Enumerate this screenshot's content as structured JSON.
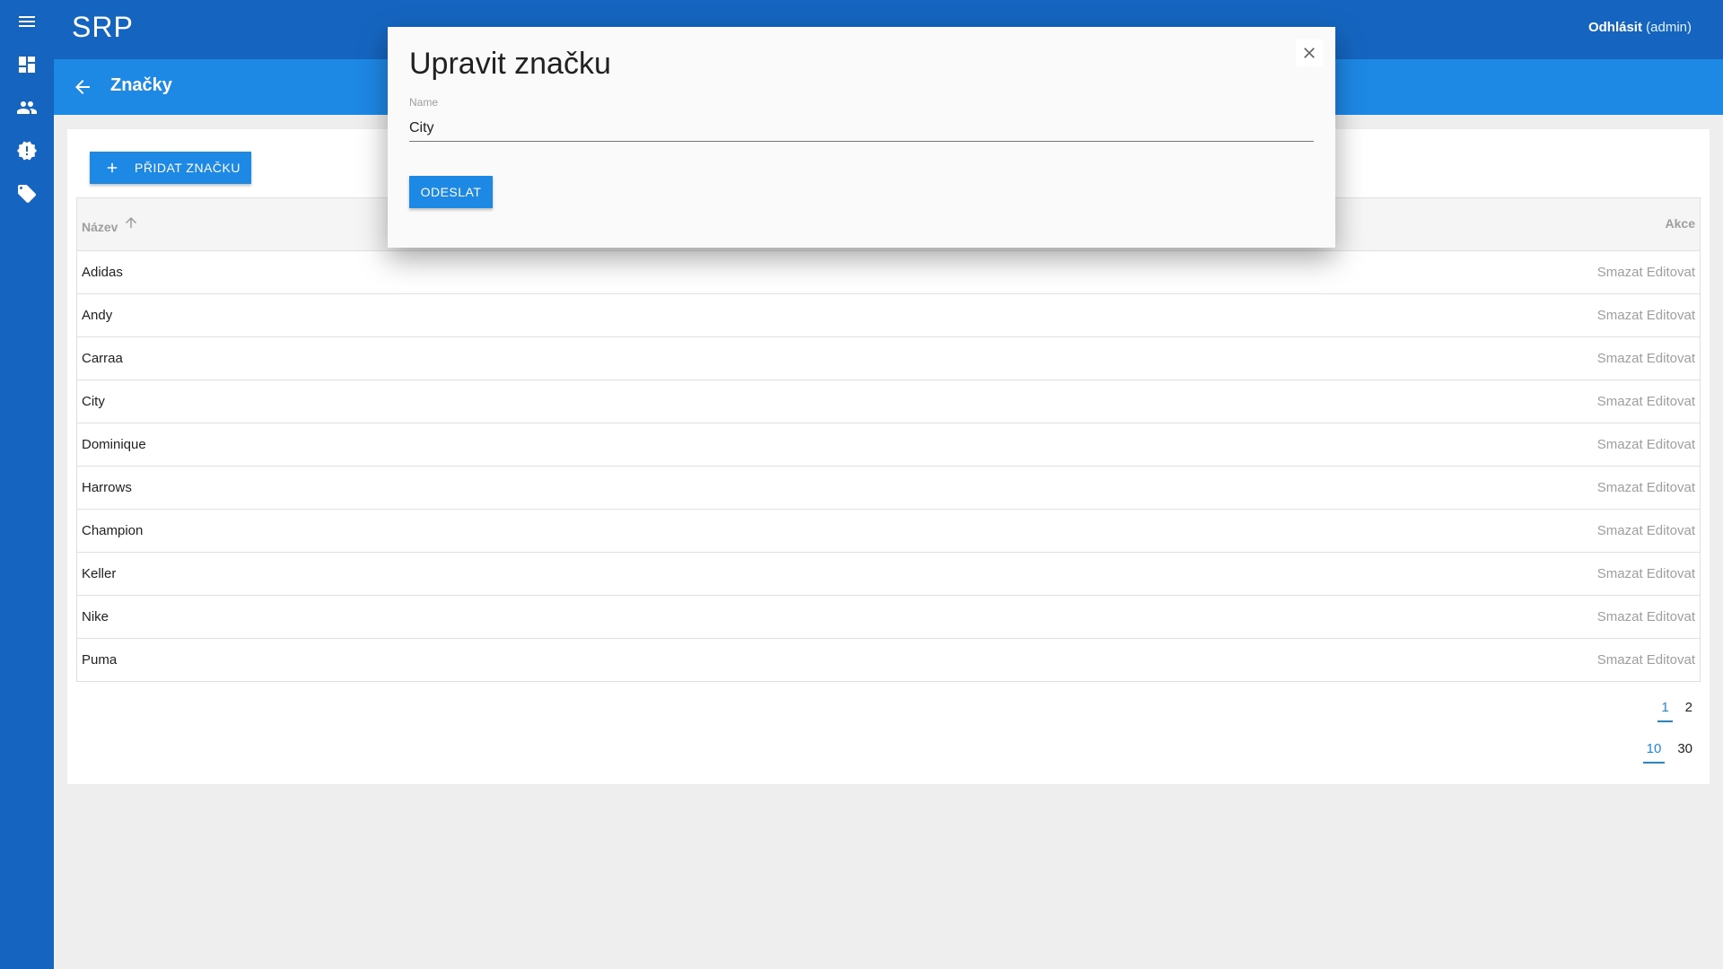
{
  "app": {
    "title": "SRP",
    "logout_label": "Odhlásit",
    "user": "(admin)"
  },
  "nav": {
    "items": [
      {
        "name": "menu",
        "icon": "menu-icon"
      },
      {
        "name": "dashboard",
        "icon": "dashboard-icon"
      },
      {
        "name": "users",
        "icon": "users-icon"
      },
      {
        "name": "alerts",
        "icon": "alert-badge-icon"
      },
      {
        "name": "brands",
        "icon": "tag-icon"
      }
    ]
  },
  "page": {
    "title": "Značky",
    "back_icon": "arrow-back-icon"
  },
  "toolbar": {
    "add_label": "PŘIDAT ZNAČKU"
  },
  "table": {
    "columns": {
      "name": "Název",
      "actions": "Akce"
    },
    "sort": "ascending",
    "delete_label": "Smazat",
    "edit_label": "Editovat",
    "rows": [
      "Adidas",
      "Andy",
      "Carraa",
      "City",
      "Dominique",
      "Harrows",
      "Champion",
      "Keller",
      "Nike",
      "Puma"
    ]
  },
  "pagination": {
    "pages": [
      "1",
      "2"
    ],
    "current_page": "1",
    "page_sizes": [
      "10",
      "30"
    ],
    "current_size": "10"
  },
  "modal": {
    "title": "Upravit značku",
    "field_label": "Name",
    "field_value": "City",
    "submit_label": "ODESLAT"
  },
  "colors": {
    "topbar": "#1565c0",
    "subbar": "#1e88e5",
    "accent": "#1e88e5",
    "background": "#eeeeee"
  }
}
